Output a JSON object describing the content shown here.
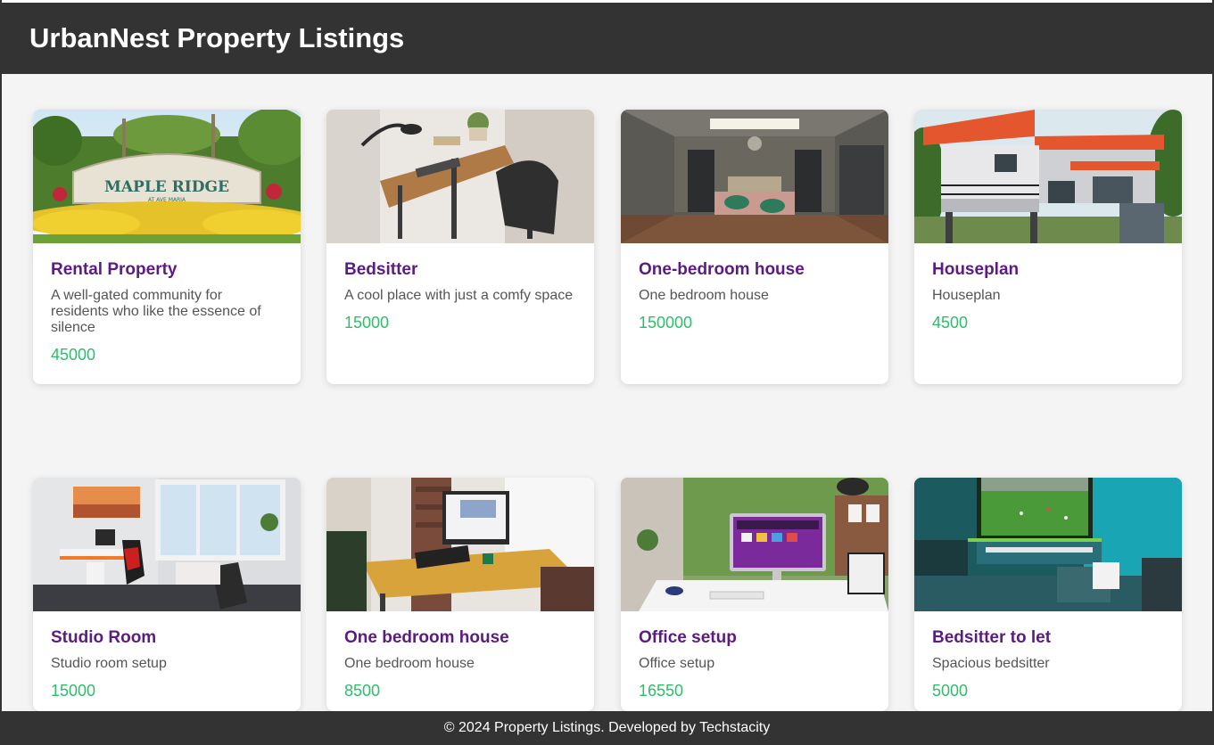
{
  "header": {
    "title": "UrbanNest Property Listings"
  },
  "listings": [
    {
      "title": "Rental Property",
      "description": "A well-gated community for residents who like the essence of silence",
      "price": "45000",
      "image_sign_text": "MAPLE RIDGE",
      "image_sign_subtext": "AT AVE MARIA"
    },
    {
      "title": "Bedsitter",
      "description": "A cool place with just a comfy space",
      "price": "15000"
    },
    {
      "title": "One-bedroom house",
      "description": "One bedroom house",
      "price": "150000"
    },
    {
      "title": "Houseplan",
      "description": "Houseplan",
      "price": "4500"
    },
    {
      "title": "Studio Room",
      "description": "Studio room setup",
      "price": "15000"
    },
    {
      "title": "One bedroom house",
      "description": "One bedroom house",
      "price": "8500"
    },
    {
      "title": "Office setup",
      "description": "Office setup",
      "price": "16550"
    },
    {
      "title": "Bedsitter to let",
      "description": "Spacious bedsitter",
      "price": "5000"
    }
  ],
  "footer": {
    "text": "© 2024 Property Listings. Developed by Techstacity"
  },
  "colors": {
    "header_bg": "#333333",
    "page_bg": "#f4f4f4",
    "title": "#5b1c82",
    "price": "#2ebd6b",
    "description": "#555555"
  }
}
